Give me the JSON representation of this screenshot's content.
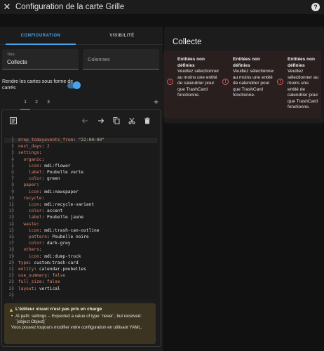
{
  "header": {
    "title": "Configuration de la carte Grille",
    "close_glyph": "✕",
    "help_glyph": "?"
  },
  "tabs": [
    {
      "label": "CONFIGURATION"
    },
    {
      "label": "VISIBILITÉ"
    }
  ],
  "fields": {
    "title": {
      "label": "Titre",
      "value": "Collecte"
    },
    "columns": {
      "placeholder": "Colonnes"
    }
  },
  "toggle": {
    "label": "Rendre les cartes sous forme de carrés",
    "checked": true
  },
  "subtabs": [
    {
      "label": "1"
    },
    {
      "label": "2"
    },
    {
      "label": "3"
    }
  ],
  "toolbar": {
    "add_glyph": "+"
  },
  "icons": [
    "code-icon",
    "undo-icon",
    "redo-icon",
    "copy-icon",
    "cut-icon",
    "delete-icon",
    "warning-icon",
    "error-icon"
  ],
  "code": [
    {
      "n": "1",
      "k": "drop_todayevents_from",
      "v": "\"22:00:00\"",
      "t": "s"
    },
    {
      "n": "2",
      "k": "next_days",
      "v": "2",
      "t": "n"
    },
    {
      "n": "3",
      "k": "settings",
      "v": ""
    },
    {
      "n": "4",
      "k": "  organic",
      "v": ""
    },
    {
      "n": "5",
      "k": "    icon",
      "v": "mdi:flower",
      "t": "v"
    },
    {
      "n": "6",
      "k": "    label",
      "v": "Poubelle verte",
      "t": "v"
    },
    {
      "n": "7",
      "k": "    color",
      "v": "green",
      "t": "v"
    },
    {
      "n": "8",
      "k": "  paper",
      "v": ""
    },
    {
      "n": "9",
      "k": "    icon",
      "v": "mdi:newspaper",
      "t": "v"
    },
    {
      "n": "10",
      "k": "  recycle",
      "v": ""
    },
    {
      "n": "11",
      "k": "    icon",
      "v": "mdi:recycle-variant",
      "t": "v"
    },
    {
      "n": "12",
      "k": "    color",
      "v": "accent",
      "t": "v"
    },
    {
      "n": "13",
      "k": "    label",
      "v": "Poubelle jaune",
      "t": "v"
    },
    {
      "n": "14",
      "k": "  waste",
      "v": ""
    },
    {
      "n": "15",
      "k": "    icon",
      "v": "mdi:trash-can-outline",
      "t": "v"
    },
    {
      "n": "16",
      "k": "    pattern",
      "v": "Poubelle noire",
      "t": "v"
    },
    {
      "n": "17",
      "k": "    color",
      "v": "dark-grey",
      "t": "v"
    },
    {
      "n": "18",
      "k": "  others",
      "v": ""
    },
    {
      "n": "19",
      "k": "    icon",
      "v": "mdi:dump-truck",
      "t": "v"
    },
    {
      "n": "20",
      "k": "type",
      "v": "custom:trash-card",
      "t": "v"
    },
    {
      "n": "21",
      "k": "entity",
      "v": "calendar.poubelles",
      "t": "v"
    },
    {
      "n": "22",
      "k": "use_summary",
      "v": "false",
      "t": "b"
    },
    {
      "n": "23",
      "k": "full_size",
      "v": "false",
      "t": "b"
    },
    {
      "n": "24",
      "k": "layout",
      "v": "vertical",
      "t": "v"
    },
    {
      "n": "25",
      "k": "",
      "v": ""
    }
  ],
  "warning": {
    "title": "L'éditeur visuel n'est pas pris en charge",
    "bullet": "At path: settings -- Expected a value of type `never`, but received: `[object Object]`",
    "footer": "Vous pouvez toujours modifier votre configuration en utilisant YAML."
  },
  "preview": {
    "title": "Collecte",
    "errors": [
      {
        "title": "Entitées non définies",
        "body": "Veuillez sélectionner au moins une entité de calendrier pour que TrashCard fonctionne."
      },
      {
        "title": "Entitées non définies",
        "body": "Veuillez sélectionner au moins une entité de calendrier pour que TrashCard fonctionne."
      },
      {
        "title": "Entitées non définies",
        "body": "Veuillez sélectionner au moins une entité de calendrier pour que TrashCard fonctionne."
      }
    ]
  },
  "colors": {
    "accent": "#4aa3e8",
    "warning": "#e0b33a",
    "error": "#d86060"
  }
}
